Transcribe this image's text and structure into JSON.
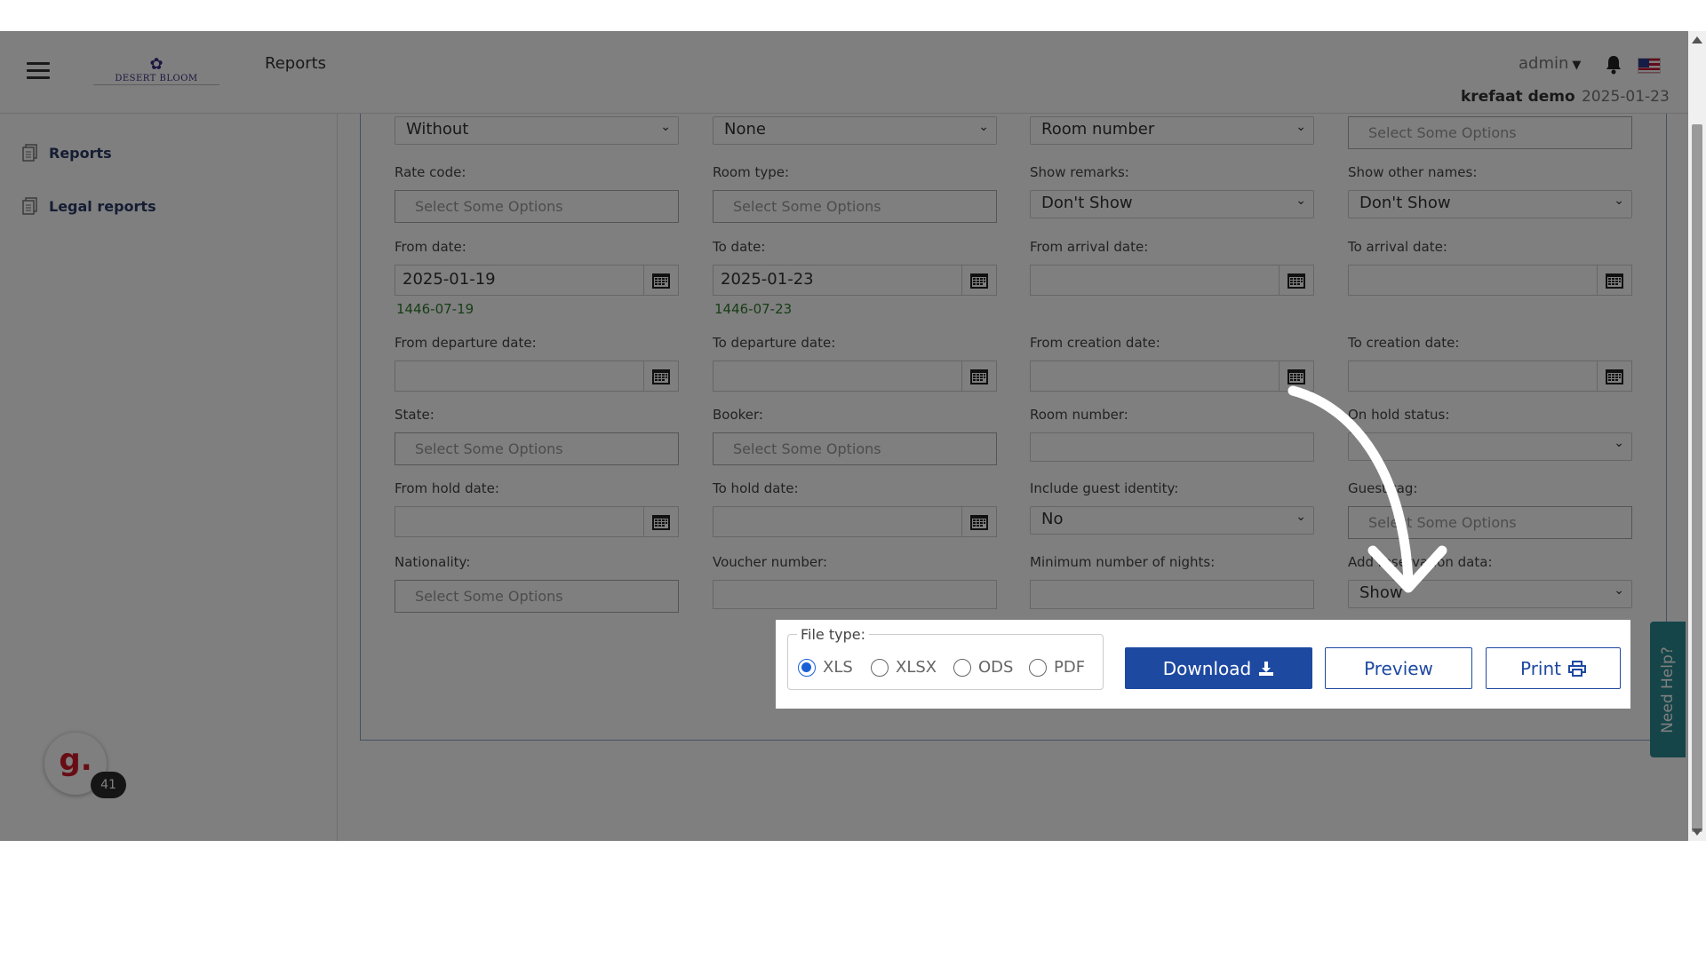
{
  "header": {
    "page_title": "Reports",
    "logo_text": "DESERT BLOOM",
    "user": "admin",
    "hotel_name": "krefaat demo",
    "current_date": "2025-01-23",
    "icons": [
      "menu-icon",
      "chevron-down-icon",
      "bell-icon",
      "us-flag-icon"
    ]
  },
  "sidebar": {
    "items": [
      {
        "label": "Reports",
        "icon": "report-icon"
      },
      {
        "label": "Legal reports",
        "icon": "report-icon"
      }
    ],
    "widget_badge": "41",
    "widget_letter": "g."
  },
  "form": {
    "row0": {
      "sel1": "Without",
      "sel2": "None",
      "sel3": "Room number",
      "multi4": "Select Some Options"
    },
    "rate_code": {
      "label": "Rate code:",
      "placeholder": "Select Some Options"
    },
    "room_type": {
      "label": "Room type:",
      "placeholder": "Select Some Options"
    },
    "show_remarks": {
      "label": "Show remarks:",
      "value": "Don't Show"
    },
    "show_other_names": {
      "label": "Show other names:",
      "value": "Don't Show"
    },
    "from_date": {
      "label": "From date:",
      "value": "2025-01-19",
      "hijri": "1446-07-19"
    },
    "to_date": {
      "label": "To date:",
      "value": "2025-01-23",
      "hijri": "1446-07-23"
    },
    "from_arrival_date": {
      "label": "From arrival date:"
    },
    "to_arrival_date": {
      "label": "To arrival date:"
    },
    "from_departure_date": {
      "label": "From departure date:"
    },
    "to_departure_date": {
      "label": "To departure date:"
    },
    "from_creation_date": {
      "label": "From creation date:"
    },
    "to_creation_date": {
      "label": "To creation date:"
    },
    "state": {
      "label": "State:",
      "placeholder": "Select Some Options"
    },
    "booker": {
      "label": "Booker:",
      "placeholder": "Select Some Options"
    },
    "room_number": {
      "label": "Room number:"
    },
    "on_hold_status": {
      "label": "On hold status:",
      "value": ""
    },
    "from_hold_date": {
      "label": "From hold date:"
    },
    "to_hold_date": {
      "label": "To hold date:"
    },
    "include_guest_identity": {
      "label": "Include guest identity:",
      "value": "No"
    },
    "guest_tag": {
      "label": "Guest tag:",
      "placeholder": "Select Some Options"
    },
    "nationality": {
      "label": "Nationality:",
      "placeholder": "Select Some Options"
    },
    "voucher_number": {
      "label": "Voucher number:"
    },
    "min_nights": {
      "label": "Minimum number of nights:"
    },
    "add_data": {
      "label": "Add reservation data:",
      "value": "Show"
    }
  },
  "actions": {
    "file_type_label": "File type:",
    "file_types": [
      "XLS",
      "XLSX",
      "ODS",
      "PDF"
    ],
    "selected_file_type": "XLS",
    "download_label": "Download",
    "preview_label": "Preview",
    "print_label": "Print"
  },
  "need_help": "Need Help?",
  "colors": {
    "primary": "#1e49a1",
    "sidebar_text": "#2b3a67",
    "hijri_green": "#2d7a2d",
    "need_help_bg": "#2a8a92"
  }
}
